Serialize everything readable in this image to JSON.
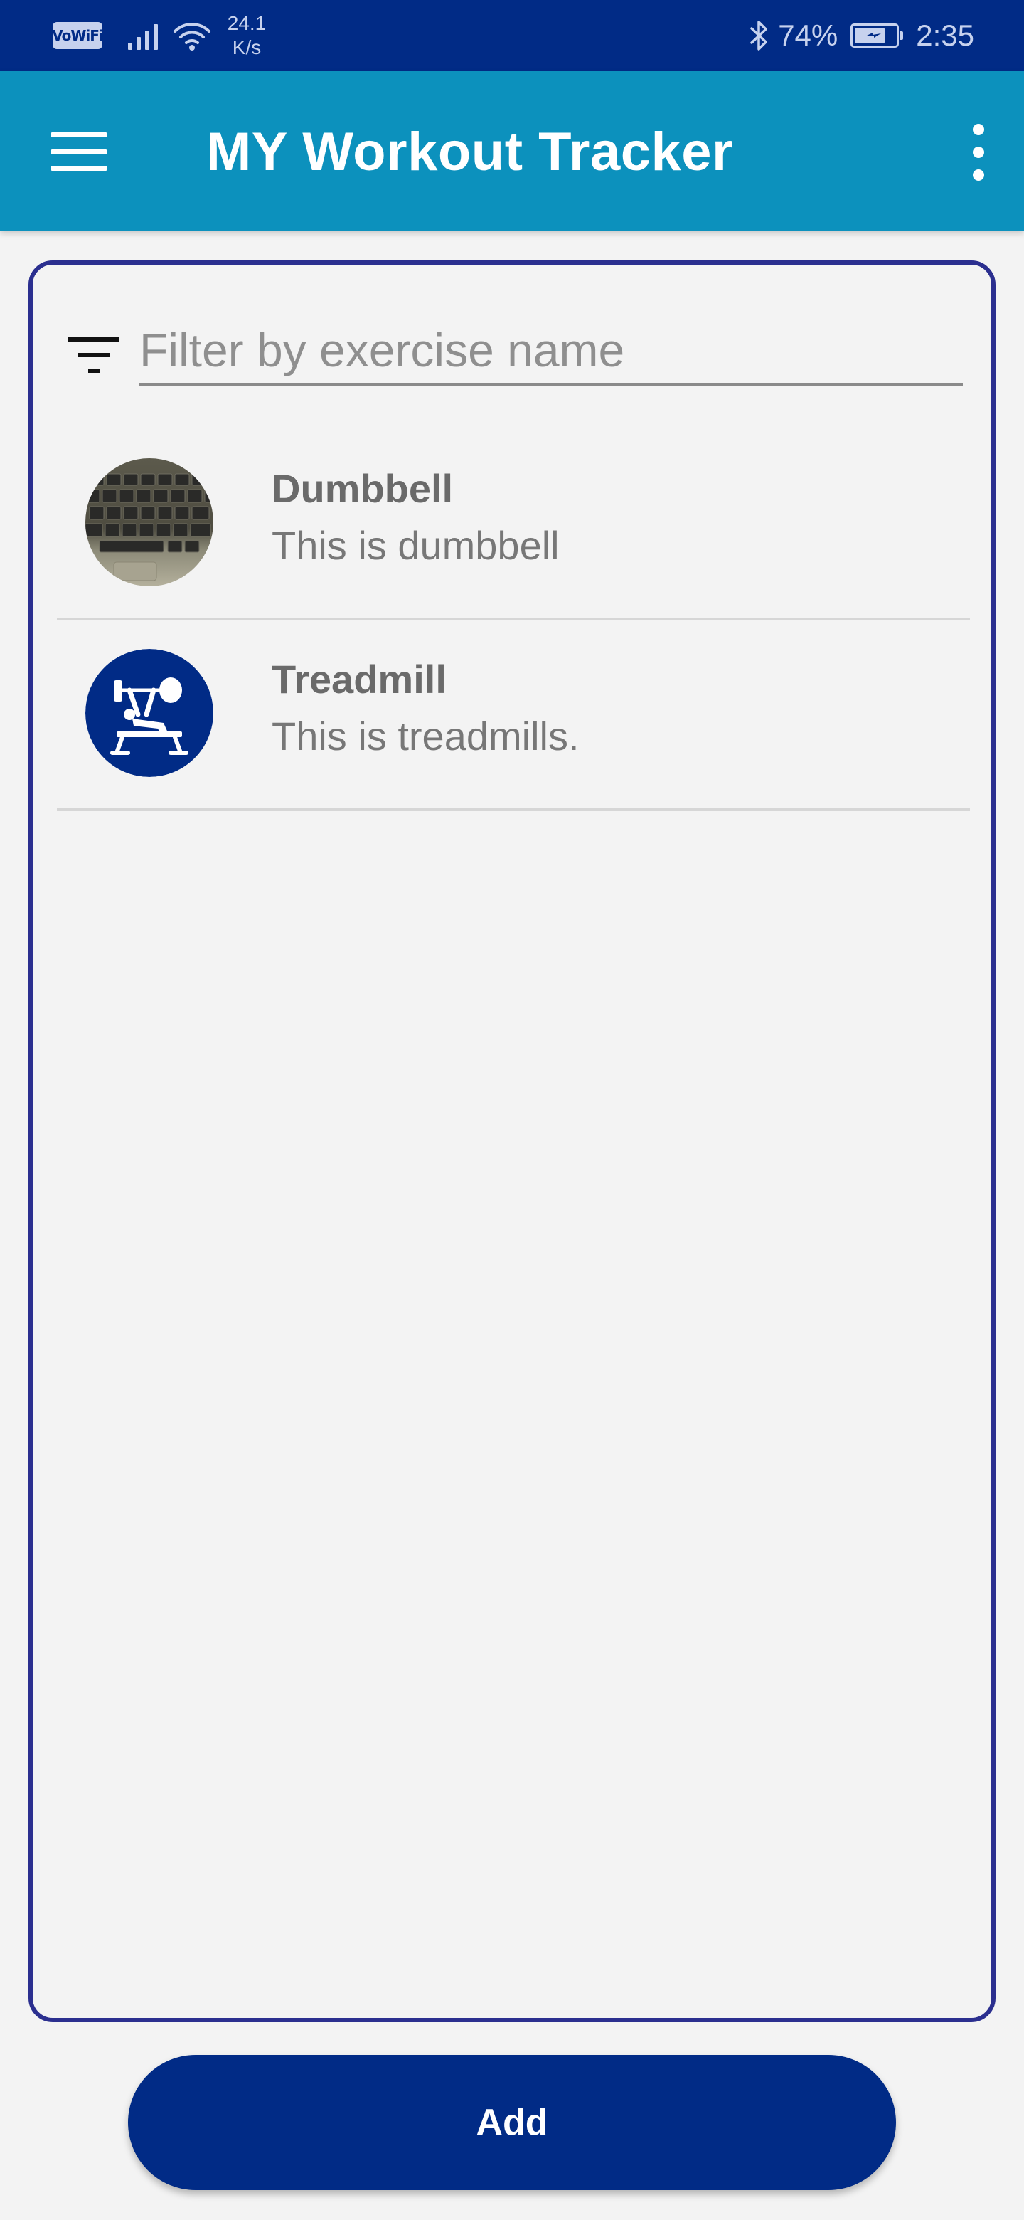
{
  "status_bar": {
    "vowifi_label": "VoWiFi",
    "network_speed_value": "24.1",
    "network_speed_unit": "K/s",
    "battery_percent": "74%",
    "battery_level": 0.74,
    "time": "2:35",
    "icons": [
      "vowifi-icon",
      "signal-icon",
      "wifi-icon",
      "bluetooth-icon",
      "battery-icon"
    ]
  },
  "app_bar": {
    "title": "MY Workout Tracker",
    "menu_icon": "hamburger-menu-icon",
    "overflow_icon": "more-vert-icon",
    "background_color": "#0c91bd"
  },
  "filter": {
    "icon": "filter-icon",
    "placeholder": "Filter by exercise name",
    "value": ""
  },
  "exercises": [
    {
      "name": "Dumbbell",
      "description": "This is dumbbell",
      "thumbnail": "keyboard-photo"
    },
    {
      "name": "Treadmill",
      "description": "This is treadmills.",
      "thumbnail": "bench-press-icon"
    }
  ],
  "add_button": {
    "label": "Add",
    "color": "#012b86"
  },
  "colors": {
    "status_bar": "#012b86",
    "card_border": "#2b2f8f",
    "background": "#f3f3f3"
  }
}
